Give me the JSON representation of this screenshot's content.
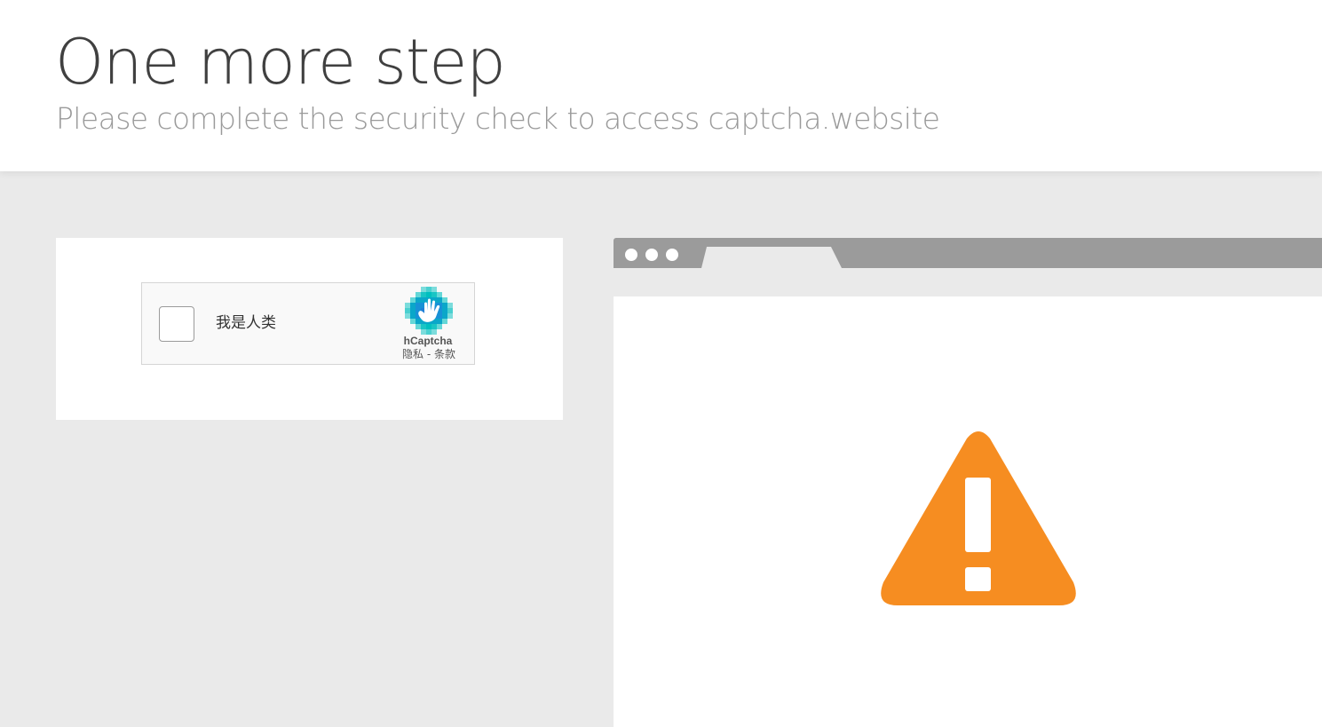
{
  "header": {
    "title": "One more step",
    "subtitle": "Please complete the security check to access captcha.website"
  },
  "captcha": {
    "checkbox_label": "我是人类",
    "brand": "hCaptcha",
    "privacy_link": "隐私",
    "separator": " - ",
    "terms_link": "条款"
  },
  "colors": {
    "warning": "#f68d21",
    "hcaptcha_accent": "#00838f",
    "browser_bar": "#9b9b9b"
  },
  "icons": {
    "checkbox": "checkbox-unchecked",
    "logo": "hcaptcha-hand-logo",
    "warning": "warning-triangle-icon"
  }
}
